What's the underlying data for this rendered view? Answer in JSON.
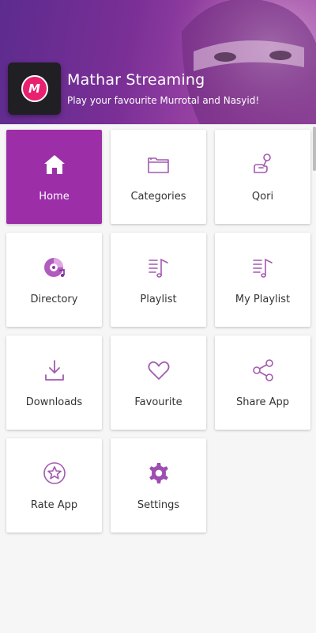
{
  "header": {
    "title": "Mathar Streaming",
    "subtitle": "Play your favourite Murrotal and Nasyid!",
    "logo_letter": "M",
    "gradient_start": "#5d2b8e",
    "gradient_end": "#b05eb4"
  },
  "colors": {
    "accent": "#9c2ea8",
    "icon": "#a25ab0",
    "logo": "#e8206f"
  },
  "menu": {
    "items": [
      {
        "label": "Home",
        "icon": "home-icon",
        "active": true
      },
      {
        "label": "Categories",
        "icon": "folder-icon",
        "active": false
      },
      {
        "label": "Qori",
        "icon": "microphone-hand-icon",
        "active": false
      },
      {
        "label": "Directory",
        "icon": "disc-icon",
        "active": false
      },
      {
        "label": "Playlist",
        "icon": "playlist-icon",
        "active": false
      },
      {
        "label": "My Playlist",
        "icon": "playlist-icon",
        "active": false
      },
      {
        "label": "Downloads",
        "icon": "download-icon",
        "active": false
      },
      {
        "label": "Favourite",
        "icon": "heart-icon",
        "active": false
      },
      {
        "label": "Share App",
        "icon": "share-icon",
        "active": false
      },
      {
        "label": "Rate App",
        "icon": "star-circle-icon",
        "active": false
      },
      {
        "label": "Settings",
        "icon": "gear-icon",
        "active": false
      }
    ]
  }
}
